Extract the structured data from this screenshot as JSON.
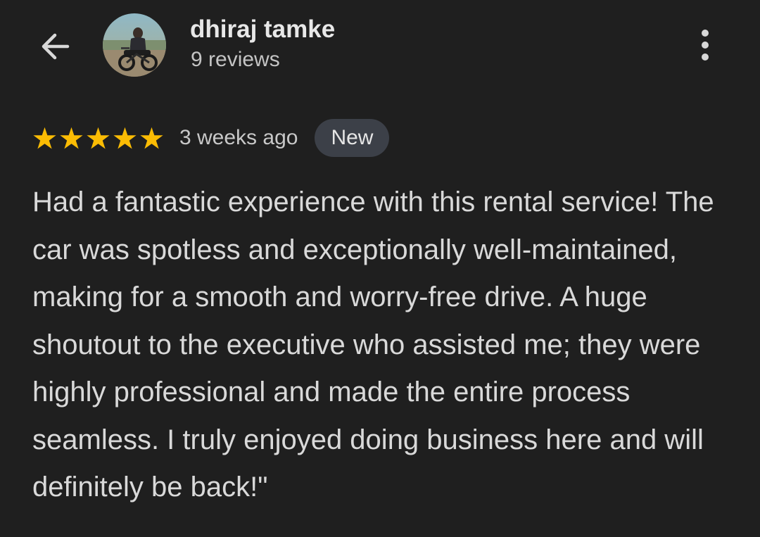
{
  "header": {
    "user_name": "dhiraj tamke",
    "review_count": "9 reviews",
    "back_icon": "arrow-back-icon",
    "more_icon": "more-vertical-icon"
  },
  "review": {
    "rating": 5,
    "max_rating": 5,
    "time_ago": "3 weeks ago",
    "badge": "New",
    "text": "Had a fantastic experience with this rental service! The car was spotless and exceptionally well-maintained, making for a smooth and worry-free drive. A huge shoutout to the executive who assisted me; they were highly professional and made the entire process seamless. I truly enjoyed doing business here and will definitely be back!\""
  },
  "colors": {
    "background": "#1f1f1f",
    "star": "#fbbc04",
    "badge_bg": "#3c4048",
    "text": "#d9d9d9"
  }
}
